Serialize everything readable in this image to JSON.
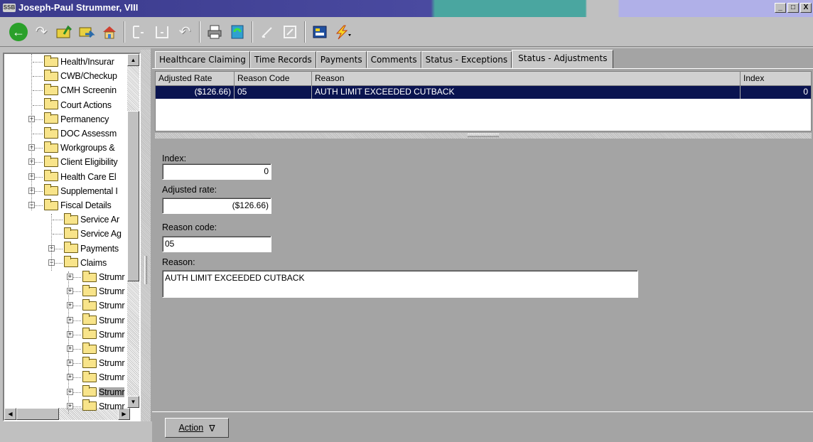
{
  "window": {
    "title": "Joseph-Paul Strummer, VIII",
    "app_icon": "SSB",
    "min": "_",
    "restore": "□",
    "close": "X"
  },
  "toolbar": {
    "icons": [
      "back-arrow-icon",
      "redo-icon",
      "folder-up-icon",
      "folder-right-icon",
      "home-icon",
      "frame-left-icon",
      "frame-bottom-icon",
      "undo-icon",
      "print-icon",
      "refresh-icon",
      "pen-icon",
      "document-icon",
      "form-icon",
      "lightning-icon"
    ]
  },
  "tree": {
    "items": [
      {
        "label": "Health/Insurar",
        "level": 1,
        "expander": ""
      },
      {
        "label": "CWB/Checkup",
        "level": 1,
        "expander": ""
      },
      {
        "label": "CMH Screenin",
        "level": 1,
        "expander": ""
      },
      {
        "label": "Court Actions",
        "level": 1,
        "expander": ""
      },
      {
        "label": "Permanency",
        "level": 1,
        "expander": "+"
      },
      {
        "label": "DOC Assessm",
        "level": 1,
        "expander": ""
      },
      {
        "label": "Workgroups &",
        "level": 1,
        "expander": "+"
      },
      {
        "label": "Client Eligibility",
        "level": 1,
        "expander": "+"
      },
      {
        "label": "Health Care El",
        "level": 1,
        "expander": "+"
      },
      {
        "label": "Supplemental I",
        "level": 1,
        "expander": "+"
      },
      {
        "label": "Fiscal Details",
        "level": 1,
        "expander": "−"
      },
      {
        "label": "Service Ar",
        "level": 2,
        "expander": ""
      },
      {
        "label": "Service Ag",
        "level": 2,
        "expander": ""
      },
      {
        "label": "Payments",
        "level": 2,
        "expander": "+"
      },
      {
        "label": "Claims",
        "level": 2,
        "expander": "−"
      },
      {
        "label": "Strumr",
        "level": 3,
        "expander": "+"
      },
      {
        "label": "Strumr",
        "level": 3,
        "expander": "+"
      },
      {
        "label": "Strumr",
        "level": 3,
        "expander": "+"
      },
      {
        "label": "Strumr",
        "level": 3,
        "expander": "+"
      },
      {
        "label": "Strumr",
        "level": 3,
        "expander": "+"
      },
      {
        "label": "Strumr",
        "level": 3,
        "expander": "+"
      },
      {
        "label": "Strumr",
        "level": 3,
        "expander": "+"
      },
      {
        "label": "Strumr",
        "level": 3,
        "expander": "+"
      },
      {
        "label": "Strumr",
        "level": 3,
        "expander": "+",
        "selected": true
      },
      {
        "label": "Strumr",
        "level": 3,
        "expander": "+"
      }
    ]
  },
  "tabs": [
    {
      "label": "Healthcare Claiming",
      "active": false
    },
    {
      "label": "Time Records",
      "active": false
    },
    {
      "label": "Payments",
      "active": false
    },
    {
      "label": "Comments",
      "active": false
    },
    {
      "label": "Status - Exceptions",
      "active": false
    },
    {
      "label": "Status - Adjustments",
      "active": true
    }
  ],
  "grid": {
    "columns": [
      "Adjusted Rate",
      "Reason Code",
      "Reason",
      "Index"
    ],
    "rows": [
      {
        "adjusted_rate": "($126.66)",
        "reason_code": "05",
        "reason": "AUTH LIMIT EXCEEDED CUTBACK",
        "index": "0"
      }
    ]
  },
  "form": {
    "index_label": "Index:",
    "index_value": "0",
    "adjusted_rate_label": "Adjusted rate:",
    "adjusted_rate_value": "($126.66)",
    "reason_code_label": "Reason code:",
    "reason_code_value": "05",
    "reason_label": "Reason:",
    "reason_value": "AUTH LIMIT EXCEEDED CUTBACK"
  },
  "action": {
    "label": "Action",
    "arrow": "∇"
  },
  "colors": {
    "title_bar": "#3a3a8c",
    "selected_row": "#0a1450",
    "panel_bg": "#a4a4a4"
  }
}
